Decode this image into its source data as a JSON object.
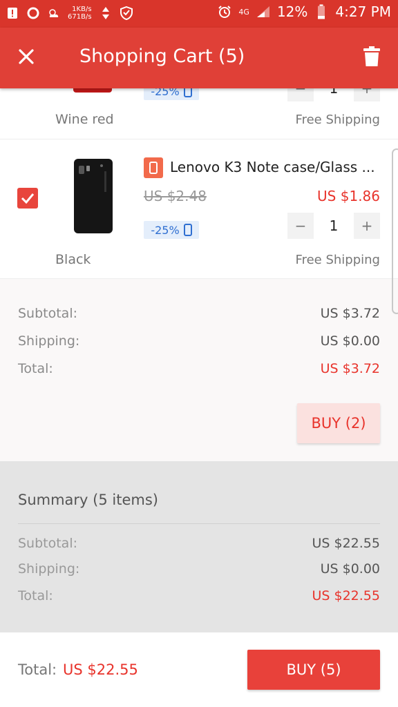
{
  "status_bar": {
    "speed_up": "1KB/s",
    "speed_down": "671B/s",
    "network": "4G",
    "battery": "12%",
    "time": "4:27 PM"
  },
  "app_bar": {
    "title": "Shopping Cart (5)",
    "color": "#e04037"
  },
  "items": [
    {
      "color_label": "Wine red",
      "discount": "-25%",
      "quantity": "1",
      "shipping": "Free Shipping"
    },
    {
      "title": "Lenovo K3 Note case/Glass ...",
      "old_price": "US $2.48",
      "price": "US $1.86",
      "discount": "-25%",
      "quantity": "1",
      "color_label": "Black",
      "shipping": "Free Shipping",
      "checked": true
    }
  ],
  "store_subtotal": {
    "subtotal_label": "Subtotal:",
    "subtotal": "US $3.72",
    "shipping_label": "Shipping:",
    "shipping": "US $0.00",
    "total_label": "Total:",
    "total": "US $3.72",
    "buy_label": "BUY (2)"
  },
  "summary": {
    "title": "Summary (5 items)",
    "subtotal_label": "Subtotal:",
    "subtotal": "US $22.55",
    "shipping_label": "Shipping:",
    "shipping": "US $0.00",
    "total_label": "Total:",
    "total": "US $22.55"
  },
  "bottom_bar": {
    "total_label": "Total:",
    "total": "US $22.55",
    "buy_label": "BUY (5)"
  },
  "colors": {
    "accent": "#e8332b",
    "status_bar": "#d9352b"
  }
}
